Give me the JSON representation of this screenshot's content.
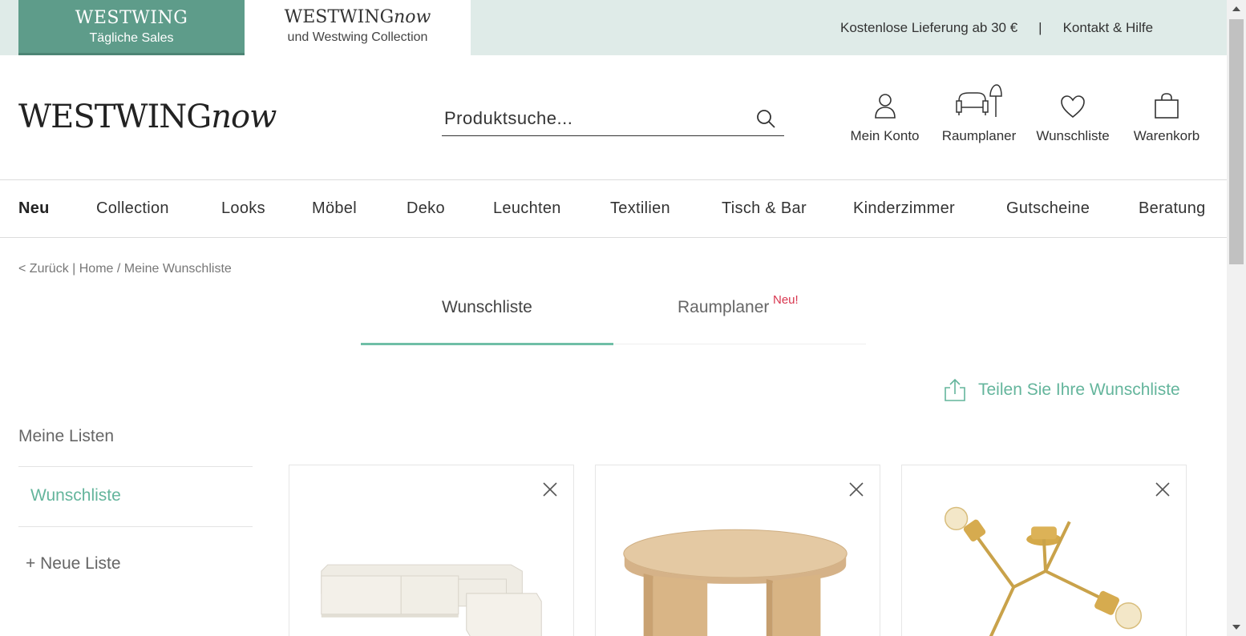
{
  "top_bar": {
    "sales_tab": {
      "brand": "WESTWING",
      "subtitle": "Tägliche Sales"
    },
    "now_tab": {
      "brand_main": "WESTWING",
      "brand_script": "now",
      "subtitle": "und Westwing Collection"
    },
    "delivery_text": "Kostenlose Lieferung ab 30 €",
    "separator": "|",
    "help_link": "Kontakt & Hilfe"
  },
  "header": {
    "logo_main": "WESTWING",
    "logo_script": "now",
    "search": {
      "placeholder": "Produktsuche..."
    },
    "actions": [
      {
        "label": "Mein Konto",
        "icon": "user-icon"
      },
      {
        "label": "Raumplaner",
        "icon": "room-planner-icon"
      },
      {
        "label": "Wunschliste",
        "icon": "heart-icon"
      },
      {
        "label": "Warenkorb",
        "icon": "shopping-bag-icon"
      }
    ]
  },
  "nav": {
    "items": [
      "Neu",
      "Collection",
      "Looks",
      "Möbel",
      "Deko",
      "Leuchten",
      "Textilien",
      "Tisch & Bar",
      "Kinderzimmer",
      "Gutscheine",
      "Beratung"
    ],
    "active": "Neu"
  },
  "breadcrumb": {
    "back": "< Zurück",
    "separator": "|",
    "home": "Home",
    "slash": "/",
    "current": "Meine Wunschliste"
  },
  "tabs": {
    "wishlist": "Wunschliste",
    "planner": "Raumplaner",
    "planner_badge": "Neu!",
    "active": "Wunschliste"
  },
  "share": {
    "label": "Teilen Sie Ihre Wunschliste",
    "icon": "share-icon"
  },
  "sidebar": {
    "title": "Meine Listen",
    "lists": [
      "Wunschliste"
    ],
    "new_list": "+ Neue Liste"
  },
  "products": [
    {
      "image": "sofa-image",
      "remove_icon": "close-icon"
    },
    {
      "image": "table-image",
      "remove_icon": "close-icon"
    },
    {
      "image": "lamp-image",
      "remove_icon": "close-icon"
    }
  ],
  "colors": {
    "accent": "#64b59c",
    "sales_tab_bg": "#5e9c8a",
    "top_strip_bg": "#dfebe8",
    "badge": "#d8364f"
  }
}
